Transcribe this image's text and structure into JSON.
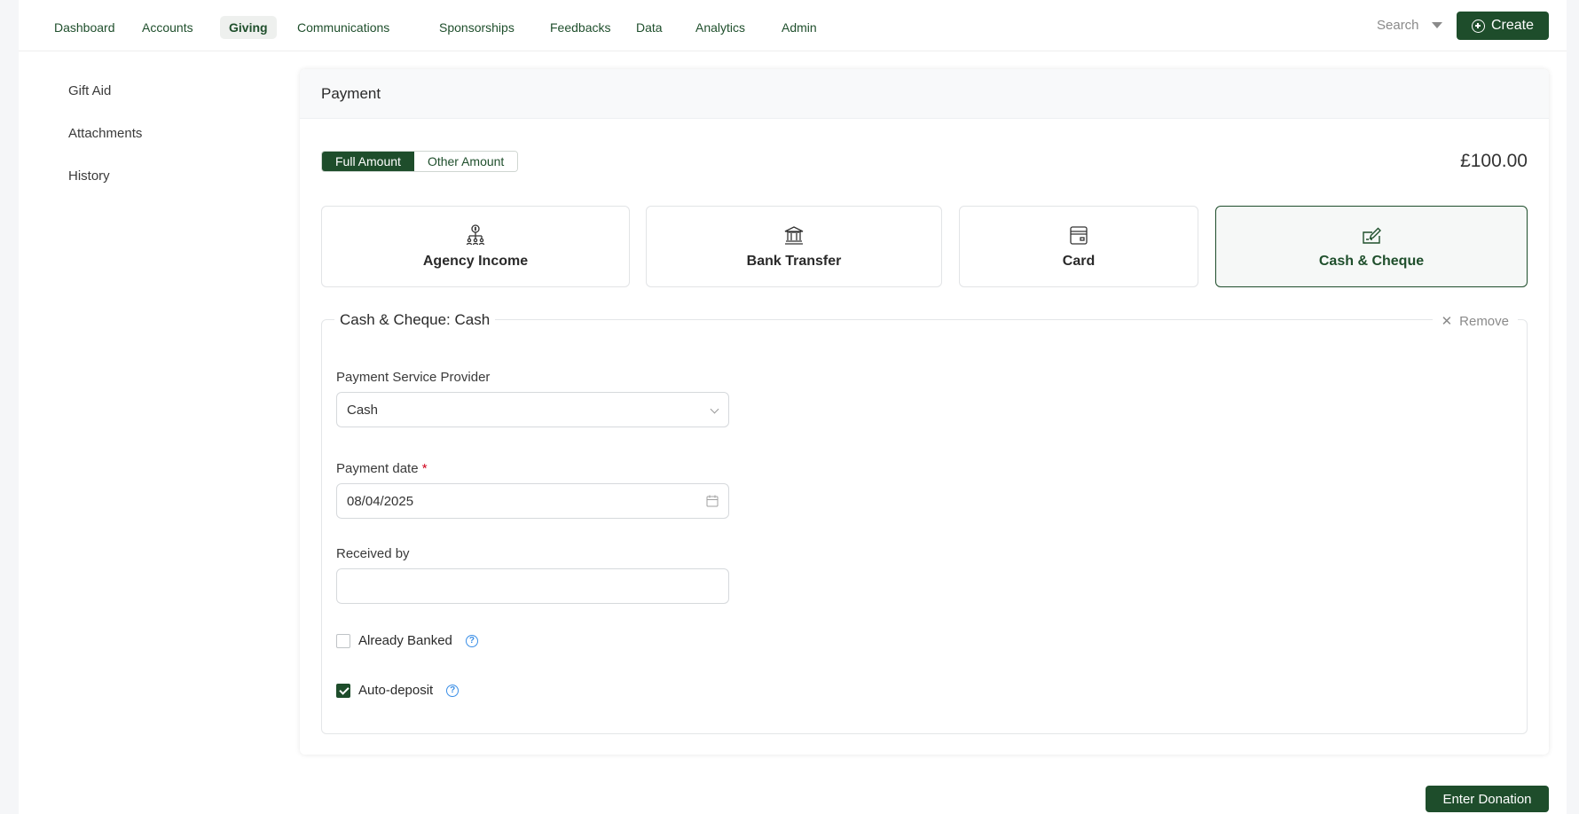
{
  "nav": {
    "items": [
      {
        "label": "Dashboard"
      },
      {
        "label": "Accounts"
      },
      {
        "label": "Giving",
        "active": true
      },
      {
        "label": "Communications"
      },
      {
        "label": "Sponsorships"
      },
      {
        "label": "Feedbacks"
      },
      {
        "label": "Data"
      },
      {
        "label": "Analytics"
      },
      {
        "label": "Admin"
      }
    ],
    "search_label": "Search",
    "create_label": "Create"
  },
  "sidebar": {
    "items": [
      {
        "label": "Gift Aid"
      },
      {
        "label": "Attachments"
      },
      {
        "label": "History"
      }
    ]
  },
  "payment": {
    "title": "Payment",
    "amount_toggle": {
      "options": [
        "Full Amount",
        "Other Amount"
      ],
      "selected": "Full Amount"
    },
    "amount": "£100.00",
    "methods": [
      {
        "label": "Agency Income",
        "icon": "agency-icon"
      },
      {
        "label": "Bank Transfer",
        "icon": "bank-icon"
      },
      {
        "label": "Card",
        "icon": "card-icon"
      },
      {
        "label": "Cash & Cheque",
        "icon": "cheque-icon",
        "selected": true
      }
    ],
    "section": {
      "legend": "Cash & Cheque: Cash",
      "remove_label": "Remove",
      "provider_label": "Payment Service Provider",
      "provider_value": "Cash",
      "date_label": "Payment date",
      "date_required_mark": "*",
      "date_value": "08/04/2025",
      "received_by_label": "Received by",
      "received_by_value": "",
      "already_banked_label": "Already Banked",
      "already_banked_checked": false,
      "auto_deposit_label": "Auto-deposit",
      "auto_deposit_checked": true,
      "help_glyph": "?"
    },
    "submit_label": "Enter Donation"
  },
  "colors": {
    "brand": "#1e4d2b",
    "required": "#d0021b",
    "help": "#3a8ee6"
  }
}
